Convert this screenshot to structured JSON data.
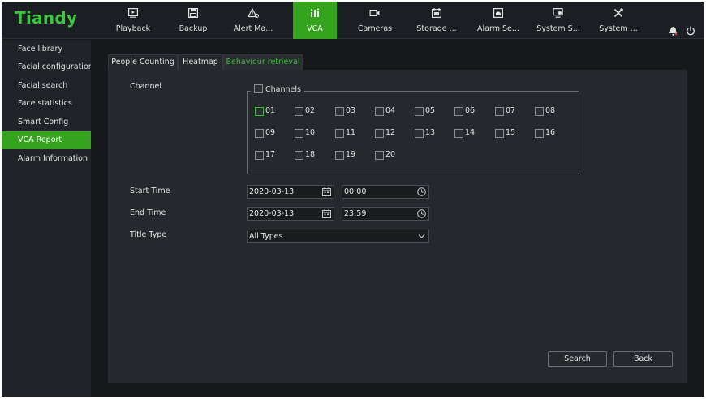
{
  "brand": {
    "logo_text": "Tiandy",
    "accent": "#36a31f"
  },
  "topnav": [
    {
      "label": "Playback",
      "icon": "playback-icon",
      "active": false
    },
    {
      "label": "Backup",
      "icon": "backup-icon",
      "active": false
    },
    {
      "label": "Alert Ma...",
      "icon": "alert-icon",
      "active": false
    },
    {
      "label": "VCA",
      "icon": "vca-icon",
      "active": true
    },
    {
      "label": "Cameras",
      "icon": "camera-icon",
      "active": false
    },
    {
      "label": "Storage ...",
      "icon": "storage-icon",
      "active": false
    },
    {
      "label": "Alarm Se...",
      "icon": "alarm-settings-icon",
      "active": false
    },
    {
      "label": "System S...",
      "icon": "system-settings-icon",
      "active": false
    },
    {
      "label": "System ...",
      "icon": "system-tools-icon",
      "active": false
    }
  ],
  "topright": {
    "bell_icon": "bell-icon",
    "power_icon": "power-icon"
  },
  "sidebar": {
    "items": [
      {
        "label": "Face library",
        "active": false
      },
      {
        "label": "Facial configuration",
        "active": false
      },
      {
        "label": "Facial search",
        "active": false
      },
      {
        "label": "Face statistics",
        "active": false
      },
      {
        "label": "Smart Config",
        "active": false
      },
      {
        "label": "VCA Report",
        "active": true
      },
      {
        "label": "Alarm Information",
        "active": false
      }
    ]
  },
  "tabs": [
    {
      "label": "People Counting",
      "active": false
    },
    {
      "label": "Heatmap",
      "active": false
    },
    {
      "label": "Behaviour retrieval",
      "active": true
    }
  ],
  "form": {
    "channel_label": "Channel",
    "channels_group_label": "Channels",
    "channels": [
      "01",
      "02",
      "03",
      "04",
      "05",
      "06",
      "07",
      "08",
      "09",
      "10",
      "11",
      "12",
      "13",
      "14",
      "15",
      "16",
      "17",
      "18",
      "19",
      "20"
    ],
    "start_time_label": "Start Time",
    "start_date": "2020-03-13",
    "start_time": "00:00",
    "end_time_label": "End Time",
    "end_date": "2020-03-13",
    "end_time": "23:59",
    "title_type_label": "Title Type",
    "title_type_value": "All Types"
  },
  "buttons": {
    "search": "Search",
    "back": "Back"
  }
}
